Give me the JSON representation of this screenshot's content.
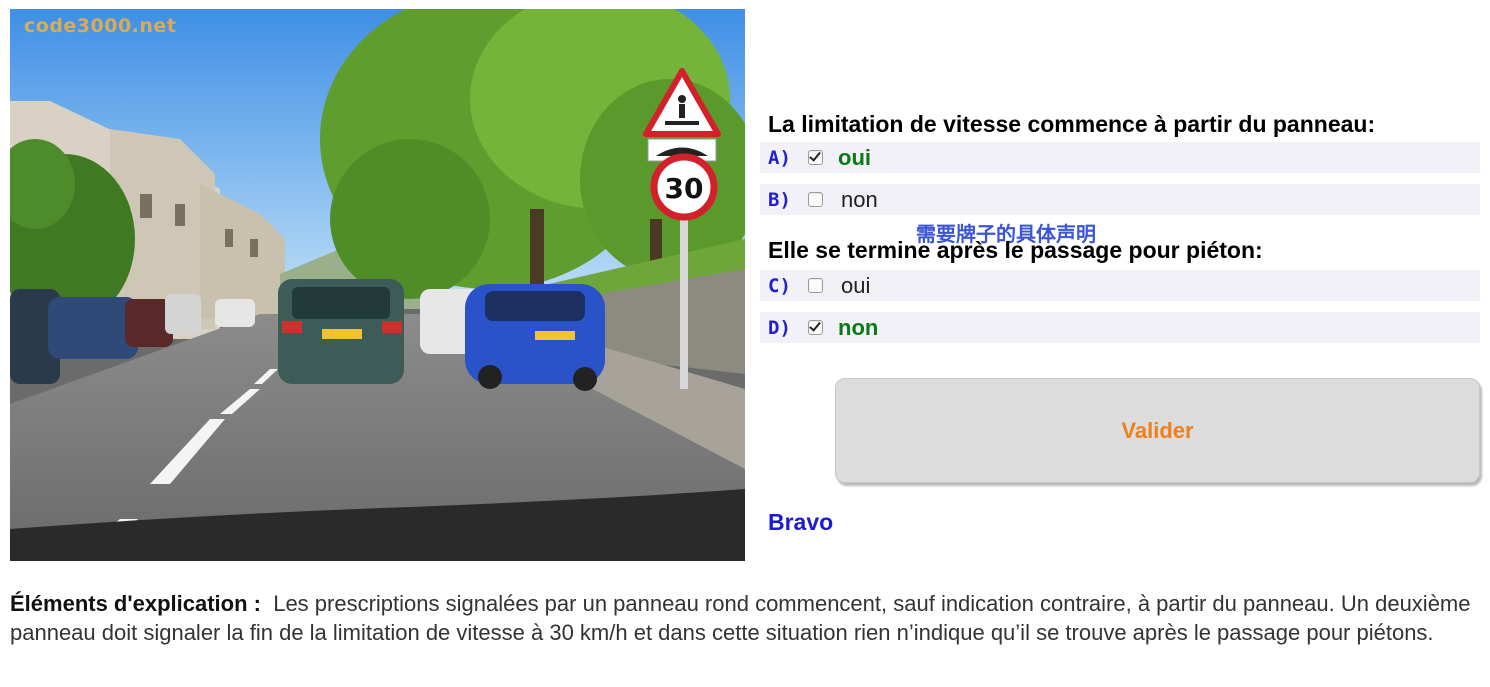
{
  "watermark": "code3000.net",
  "image_semantics": {
    "sign_speed_limit_value": "30",
    "signs": [
      "pedestrian-crossing-warning-sign",
      "speed-bump-sign",
      "speed-limit-30-sign"
    ]
  },
  "question1": {
    "title": "La limitation de vitesse commence à partir du panneau:",
    "answers": [
      {
        "letter": "A)",
        "text": "oui",
        "checked": true,
        "correct": true
      },
      {
        "letter": "B)",
        "text": "non",
        "checked": false,
        "correct": false
      }
    ]
  },
  "annotation": "需要牌子的具体声明",
  "question2": {
    "title": "Elle se termine après le passage pour piéton:",
    "answers": [
      {
        "letter": "C)",
        "text": "oui",
        "checked": false,
        "correct": false
      },
      {
        "letter": "D)",
        "text": "non",
        "checked": true,
        "correct": true
      }
    ]
  },
  "validate_button": {
    "label": "Valider"
  },
  "result": {
    "text": "Bravo"
  },
  "explanation": {
    "label": "Éléments d'explication :",
    "text": "Les prescriptions signalées par un panneau rond commencent, sauf indication contraire, à partir du panneau. Un deuxième panneau doit signaler la fin de la limitation de vitesse à 30 km/h et dans cette situation rien n’indique qu’il se trouve après le passage pour piétons."
  },
  "colors": {
    "answer_letter": "#2020d0",
    "correct_answer": "#0b7a16",
    "annotation": "#3c55d6",
    "validate_label": "#ef7f1a",
    "result_text": "#1a1ad8",
    "answer_row_bg": "#f1f1f7"
  }
}
